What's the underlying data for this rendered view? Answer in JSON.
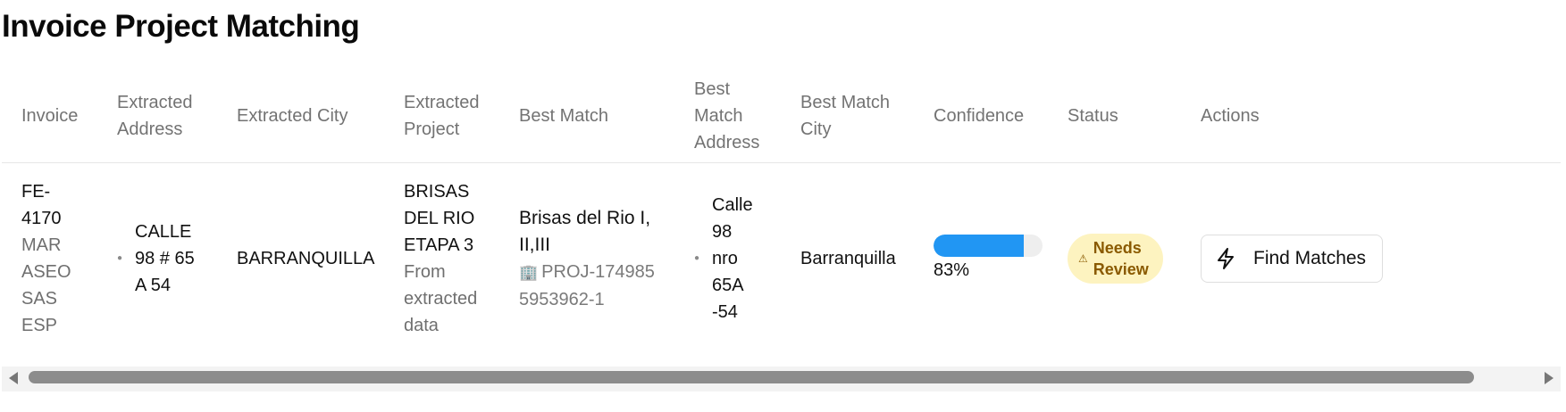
{
  "page": {
    "title": "Invoice Project Matching"
  },
  "table": {
    "headers": [
      "Invoice",
      "Extracted Address",
      "Extracted City",
      "Extracted Project",
      "Best Match",
      "Best Match Address",
      "Best Match City",
      "Confidence",
      "Status",
      "Actions"
    ],
    "rows": [
      {
        "invoice_id": "FE-4170",
        "invoice_vendor": "MAR ASEO SAS ESP",
        "extracted_address": "CALLE 98 # 65 A 54",
        "extracted_city": "BARRANQUILLA",
        "extracted_project": "BRISAS DEL RIO ETAPA 3",
        "extracted_project_note": "From extracted data",
        "best_match_name": "Brisas del Rio I, II,III",
        "best_match_id": "PROJ-1749855953962-1",
        "best_match_address": "Calle 98 nro 65A -54",
        "best_match_city": "Barranquilla",
        "confidence": 0.83,
        "confidence_label": "83%",
        "status": "Needs Review",
        "action_label": "Find Matches"
      }
    ]
  },
  "colors": {
    "accent": "#2196f3",
    "badge_bg": "#fdf3c0",
    "badge_text": "#8a5a00"
  },
  "icons": {
    "address": "map-pin-icon",
    "project_id": "building-icon",
    "status": "warning-triangle-icon",
    "action": "lightning-icon"
  }
}
